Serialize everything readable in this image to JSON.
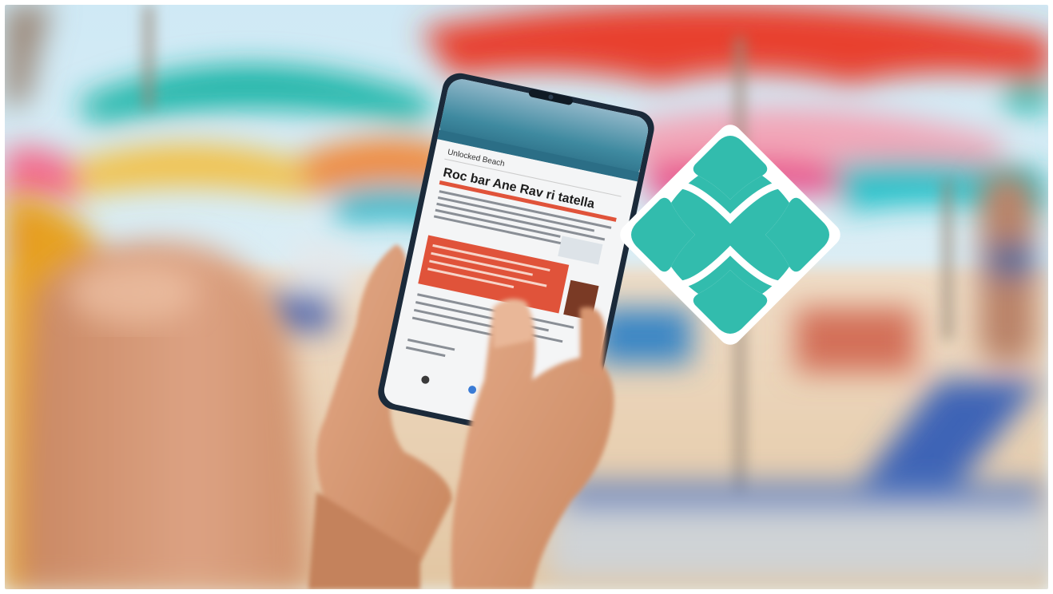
{
  "image": {
    "subject": "beach-phone-photo",
    "colors": {
      "sky": "#bfe3f2",
      "sand": "#e9d6bd",
      "umbrella_red": "#e8412f",
      "umbrella_teal": "#1fb5a8",
      "umbrella_yellow": "#f2c14a",
      "skin": "#d99a73",
      "phone_body": "#1b2a3a",
      "logo_teal": "#32bcad",
      "article_red": "#e0533a"
    },
    "logo": {
      "icon": "pix-logo-icon"
    },
    "phone": {
      "header_text": "Unlocked Beach",
      "headline_text": "Roc bar Ane Rav ri tatella"
    }
  }
}
